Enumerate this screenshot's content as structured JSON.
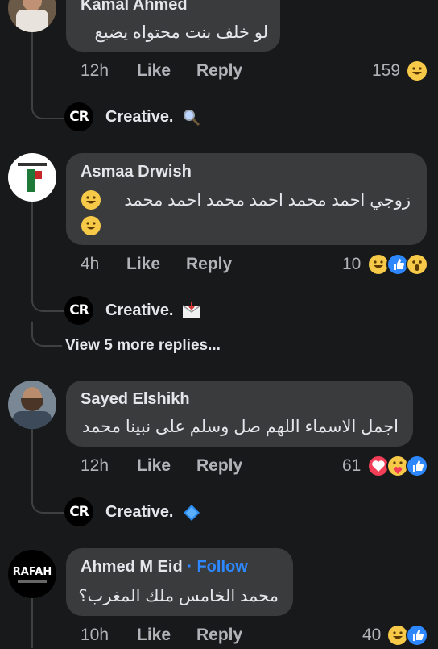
{
  "comments": [
    {
      "author": "Kamal Ahmed",
      "text": "لو خلف بنت محتواه يضيع",
      "time": "12h",
      "like": "Like",
      "reply": "Reply",
      "reactions_count": "159",
      "reactions": [
        "laugh-icon"
      ]
    },
    {
      "author": "Asmaa Drwish",
      "text_line1": "زوجي احمد محمد احمد محمد احمد محمد",
      "time": "4h",
      "like": "Like",
      "reply": "Reply",
      "reactions_count": "10",
      "reactions": [
        "laugh-icon",
        "like-icon",
        "wow-icon"
      ]
    },
    {
      "author": "Sayed Elshikh",
      "text": "اجمل الاسماء اللهم صل وسلم على نبينا محمد",
      "time": "12h",
      "like": "Like",
      "reply": "Reply",
      "reactions_count": "61",
      "reactions": [
        "love-icon",
        "care-icon",
        "like-icon"
      ]
    },
    {
      "author": "Ahmed M Eid",
      "follow": "· Follow",
      "text": "محمد الخامس ملك المغرب؟",
      "time": "10h",
      "like": "Like",
      "reply": "Reply",
      "reactions_count": "40",
      "reactions": [
        "laugh-icon",
        "like-icon"
      ]
    }
  ],
  "page_replies": [
    {
      "name": "Creative.",
      "emoji": "magnifier-icon"
    },
    {
      "name": "Creative.",
      "emoji": "envelope-icon"
    },
    {
      "name": "Creative.",
      "emoji": "diamond-icon"
    }
  ],
  "page_logo_text": "CR",
  "avatar4_text": "RAFAH",
  "view_more": "View 5 more replies...",
  "colors": {
    "background": "#18191a",
    "bubble": "#3a3b3c",
    "text": "#e4e6eb",
    "secondary_text": "#b0b3b8",
    "link_blue": "#2d88ff"
  }
}
